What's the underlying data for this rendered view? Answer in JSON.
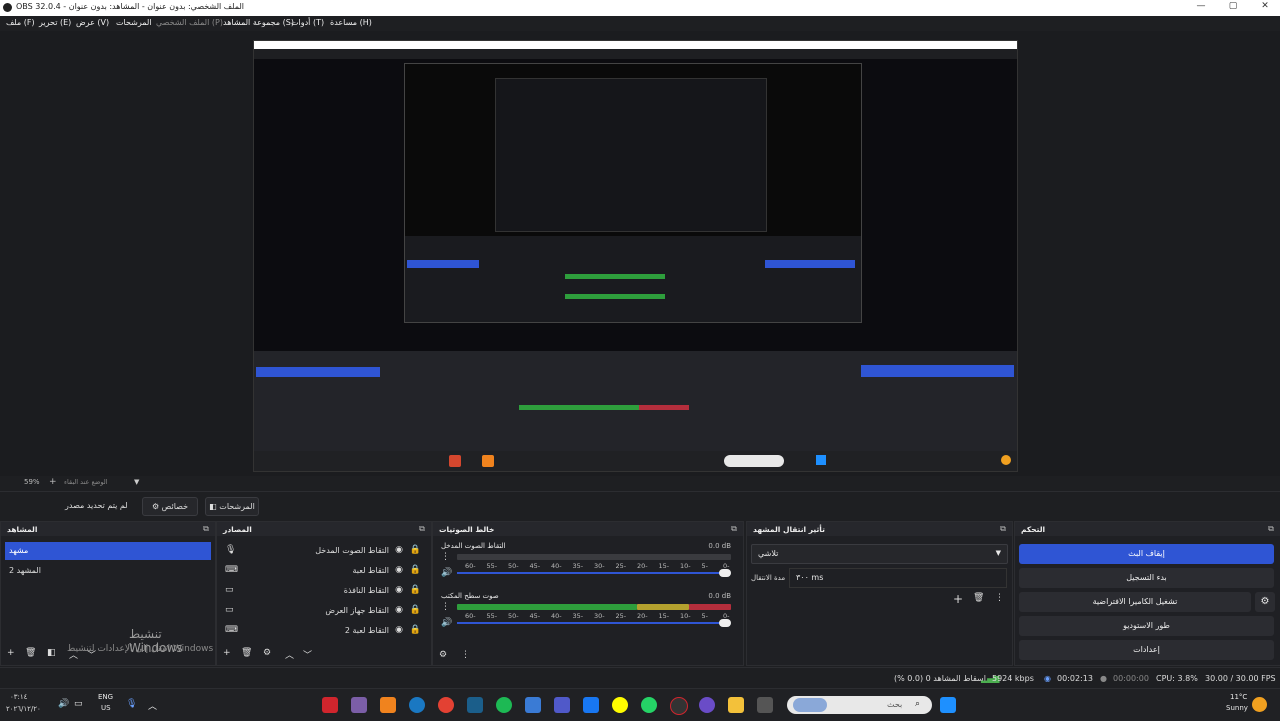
{
  "window": {
    "title": "OBS 32.0.4 - الملف الشخصي: بدون عنوان - المشاهد: بدون عنوان",
    "minimize": "—",
    "maximize": "▢",
    "close": "✕"
  },
  "menu": [
    "ملف (F)",
    "تحرير (E)",
    "عرض (V)",
    "المرشحات",
    "الملف الشخصي (P)",
    "مجموعة المشاهد (S)",
    "أدوات (T)",
    "مساعدة (H)"
  ],
  "preview_toolbar": {
    "zoom": "59%",
    "zoom_add": "+",
    "scene_dropdown": "الوضع عند البقاء",
    "dropdown_arrow": "▼"
  },
  "source_toolbar": {
    "no_source_selected": "لم يتم تحديد مصدر",
    "properties": "خصائص",
    "filters": "المرشحات"
  },
  "scenes": {
    "title": "المشاهد",
    "items": [
      "مشهد",
      "المشهد 2"
    ],
    "selected": 0
  },
  "sources": {
    "title": "المصادر",
    "items": [
      {
        "label": "التقاط الصوت المدخل",
        "icon": "mic-icon",
        "glyph": "🎙"
      },
      {
        "label": "التقاط لعبة",
        "icon": "gamepad-icon",
        "glyph": "⌨"
      },
      {
        "label": "التقاط النافذة",
        "icon": "window-icon",
        "glyph": "▭"
      },
      {
        "label": "التقاط جهاز العرض",
        "icon": "monitor-icon",
        "glyph": "▭"
      },
      {
        "label": "التقاط لعبة 2",
        "icon": "gamepad-icon",
        "glyph": "⌨"
      }
    ],
    "watermark_line1": "تنشيط Windows",
    "watermark_line2": "انتقل إلى الإعدادات لتنشيط Windows"
  },
  "audio_mixer": {
    "title": "خالط الصوتيات",
    "channels": [
      {
        "name": "التقاط الصوت المدخل",
        "db": "0.0 dB"
      },
      {
        "name": "صوت سطح المكتب",
        "db": "0.0 dB"
      }
    ],
    "ticks": [
      "0-",
      "5-",
      "10-",
      "15-",
      "20-",
      "25-",
      "30-",
      "35-",
      "40-",
      "45-",
      "50-",
      "55-",
      "60-"
    ]
  },
  "transitions": {
    "title": "تأثير انتقال المشهد",
    "type": "تلاشي",
    "duration_label": "مدة الانتقال",
    "duration_value": "٣٠٠ ms"
  },
  "controls": {
    "title": "التحكم",
    "buttons": [
      "إيقاف البث",
      "بدء التسجيل",
      "تشغيل الكاميرا الافتراضية",
      "طور الاستوديو",
      "إعدادات"
    ]
  },
  "status": {
    "dropped": "إسقاط المشاهد 0 (0.0 %)",
    "bitrate": "5924 kbps",
    "stream_time": "00:02:13",
    "rec_time": "00:00:00",
    "cpu": "CPU: 3.8%",
    "fps": "30.00 / 30.00 FPS"
  },
  "taskbar": {
    "time": "٠٣:١٤",
    "date": "٢٠٢٦/١٢/٢٠",
    "lang": "ENG",
    "region": "US",
    "weather_temp": "11°C",
    "weather_text": "Sunny",
    "search_placeholder": "بحث"
  },
  "colors": {
    "accent": "#2f55d4",
    "meter_green": "#2e9e3c",
    "meter_yellow": "#b4a12e",
    "meter_red": "#b42e3c"
  }
}
